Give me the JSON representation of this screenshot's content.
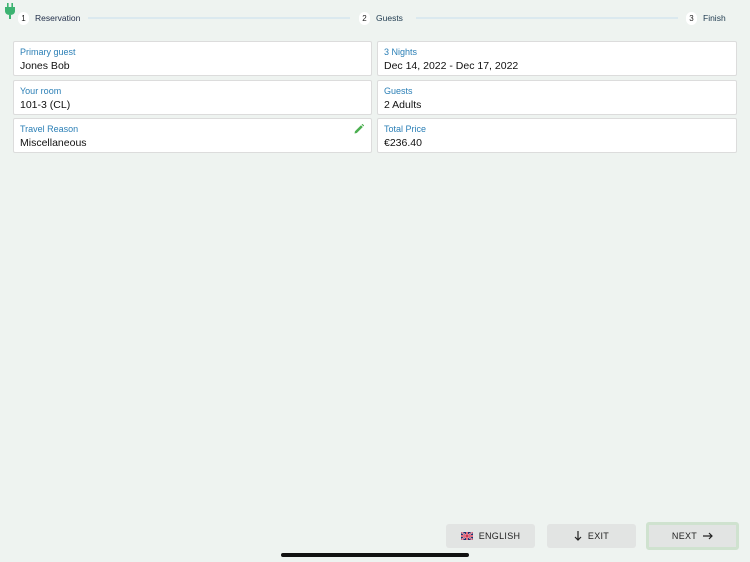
{
  "stepper": {
    "steps": [
      {
        "num": "1",
        "label": "Reservation"
      },
      {
        "num": "2",
        "label": "Guests"
      },
      {
        "num": "3",
        "label": "Finish"
      }
    ]
  },
  "cards": {
    "primary_guest": {
      "label": "Primary guest",
      "value": "Jones Bob"
    },
    "nights": {
      "label": "3 Nights",
      "value": "Dec 14, 2022 - Dec 17, 2022"
    },
    "room": {
      "label": "Your room",
      "value": "101-3 (CL)"
    },
    "guests": {
      "label": "Guests",
      "value": "2 Adults"
    },
    "travel_reason": {
      "label": "Travel Reason",
      "value": "Miscellaneous"
    },
    "total_price": {
      "label": "Total Price",
      "value": "€236.40"
    }
  },
  "footer": {
    "language_label": "ENGLISH",
    "exit_label": "EXIT",
    "next_label": "NEXT"
  },
  "icons": {
    "logo": "plug-icon",
    "edit": "pencil-icon",
    "flag": "uk-flag-icon",
    "exit": "arrow-down-icon",
    "next": "arrow-right-icon"
  },
  "colors": {
    "accent": "#2b7fb6",
    "background": "#eef3f0",
    "logo_green": "#3cb371",
    "edit_green": "#4caf50"
  }
}
